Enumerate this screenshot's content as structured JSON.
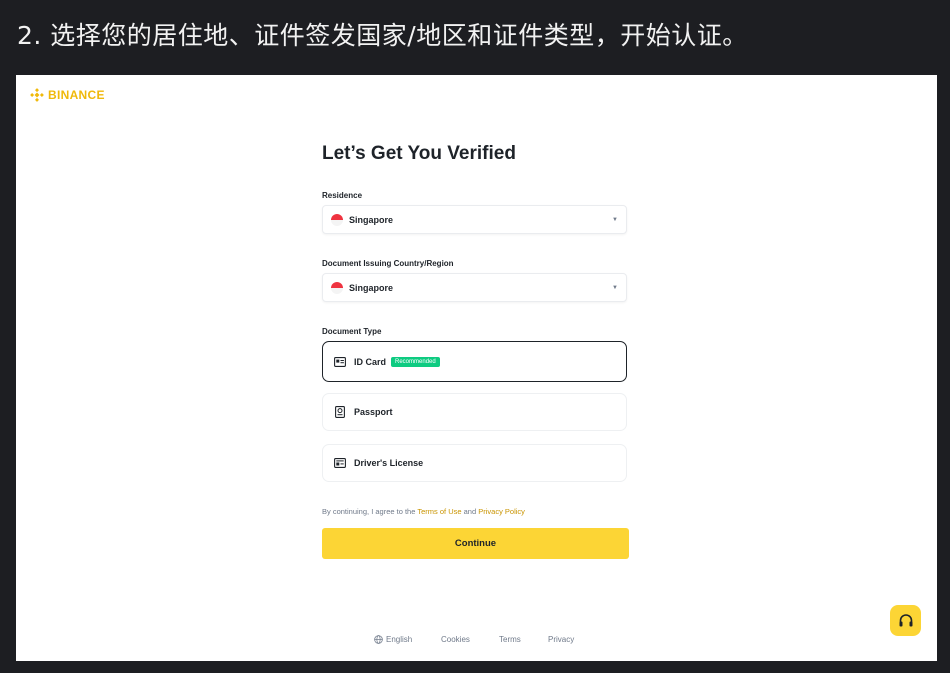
{
  "step": {
    "text": "2. 选择您的居住地、证件签发国家/地区和证件类型，开始认证。"
  },
  "brand": {
    "name": "BINANCE",
    "color": "#f0b90b"
  },
  "form": {
    "title": "Let’s Get You Verified",
    "residence": {
      "label": "Residence",
      "value": "Singapore",
      "flag_icon": "singapore-flag-icon"
    },
    "issuing_country": {
      "label": "Document Issuing Country/Region",
      "value": "Singapore",
      "flag_icon": "singapore-flag-icon"
    },
    "document_type": {
      "label": "Document Type",
      "options": [
        {
          "label": "ID Card",
          "badge": "Recommended",
          "selected": true,
          "icon": "id-card-icon"
        },
        {
          "label": "Passport",
          "selected": false,
          "icon": "passport-icon"
        },
        {
          "label": "Driver's License",
          "selected": false,
          "icon": "drivers-license-icon"
        }
      ]
    },
    "consent": {
      "prefix": "By continuing, I agree to the",
      "terms_link": "Terms of Use",
      "and": "and",
      "privacy_link": "Privacy Policy"
    },
    "continue_label": "Continue"
  },
  "footer": {
    "language": "English",
    "cookies": "Cookies",
    "terms": "Terms",
    "privacy": "Privacy"
  },
  "colors": {
    "accent": "#fcd535",
    "link": "#c99400",
    "badge": "#0ecb81",
    "text": "#1e2329"
  },
  "support_icon": "headset-icon"
}
